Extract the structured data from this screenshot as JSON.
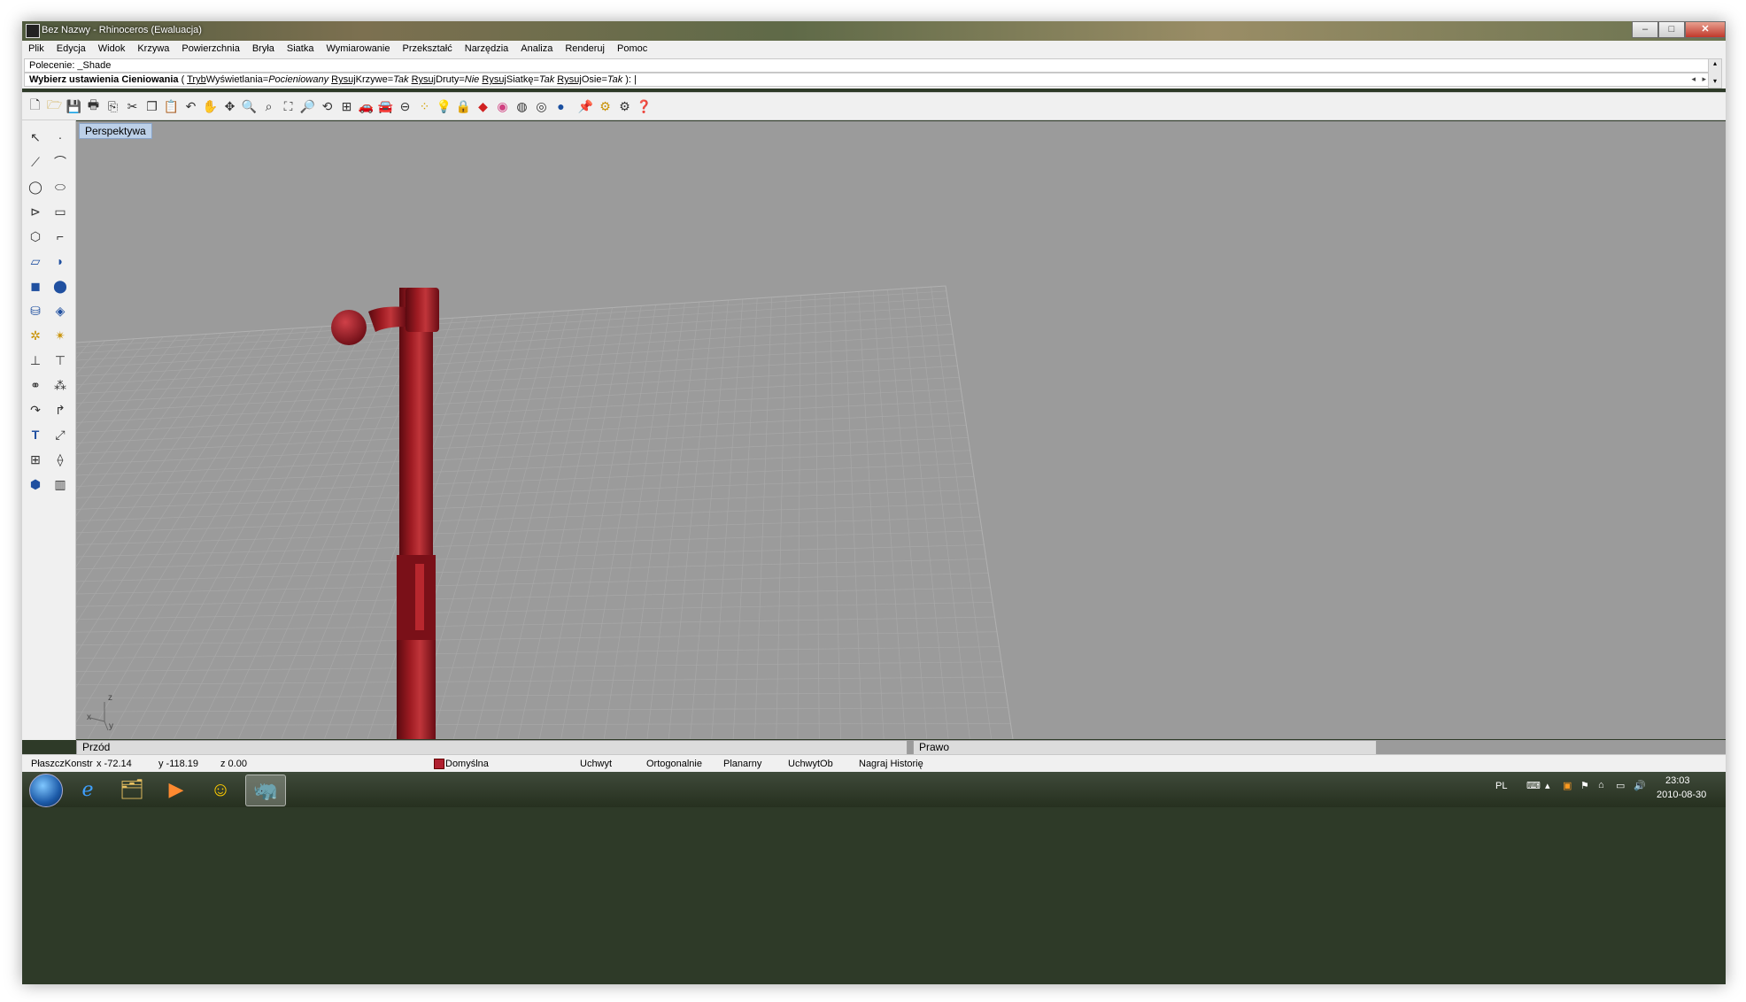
{
  "window": {
    "title": "Bez Nazwy - Rhinoceros (Ewaluacja)",
    "min_glyph": "–",
    "max_glyph": "□",
    "close_glyph": "✕"
  },
  "menu": [
    "Plik",
    "Edycja",
    "Widok",
    "Krzywa",
    "Powierzchnia",
    "Bryła",
    "Siatka",
    "Wymiarowanie",
    "Przekształć",
    "Narzędzia",
    "Analiza",
    "Renderuj",
    "Pomoc"
  ],
  "command": {
    "history": "Polecenie: _Shade",
    "prompt_bold": "Wybierz ustawienia Cieniowania",
    "opt1_key": "Tryb",
    "opt1_name": "Wyświetlania",
    "opt1_value": "Pocieniowany",
    "opt2_key": "Rysuj",
    "opt2_name": "Krzywe",
    "opt2_value": "Tak",
    "opt3_key": "Rysuj",
    "opt3_name": "Druty",
    "opt3_value": "Nie",
    "opt4_key": "Rysuj",
    "opt4_name": "Siatkę",
    "opt4_value": "Tak",
    "opt5_key": "Rysuj",
    "opt5_name": "Osie",
    "opt5_value": "Tak"
  },
  "toolbar_icons": [
    "new-file-icon",
    "open-folder-icon",
    "save-icon",
    "print-icon",
    "export-icon",
    "cut-icon",
    "copy-icon",
    "paste-icon",
    "undo-icon",
    "pan-hand-icon",
    "move-icon",
    "zoom-icon",
    "zoom-window-icon",
    "zoom-extents-icon",
    "zoom-selected-icon",
    "rotate-view-icon",
    "viewport-layout-icon",
    "car-icon",
    "car-outline-icon",
    "osnap-icon",
    "points-icon",
    "lightbulb-icon",
    "lock-icon",
    "layer-icon",
    "color-wheel-icon",
    "wireframe-sphere-icon",
    "shaded-sphere-icon",
    "rendered-sphere-icon",
    "pin-icon",
    "gear-icon",
    "options-icon",
    "help-icon"
  ],
  "left_tools": [
    "select-arrow-icon",
    "point-icon",
    "polyline-icon",
    "curve-edit-icon",
    "circle-icon",
    "ellipse-icon",
    "arc-icon",
    "rectangle-icon",
    "polygon-icon",
    "fillet-icon",
    "surface-icon",
    "surface-edit-icon",
    "box-icon",
    "boolean-icon",
    "cylinder-icon",
    "plane-icon",
    "transform-icon",
    "explode-icon",
    "split-icon",
    "trim-icon",
    "group-icon",
    "array-icon",
    "extend-icon",
    "chamfer-icon",
    "text-icon",
    "scale-icon",
    "block-icon",
    "dimension-icon",
    "cube-icon",
    "hatch-icon"
  ],
  "viewport": {
    "title": "Perspektywa",
    "axis_x": "x",
    "axis_y": "y",
    "axis_z": "z"
  },
  "bottom_viewports": {
    "front": "Przód",
    "right": "Prawo"
  },
  "status": {
    "plane": "PłaszczKonstr",
    "x": "x -72.14",
    "y": "y -118.19",
    "z": "z 0.00",
    "layer": "Domyślna",
    "snap": "Uchwyt",
    "ortho": "Ortogonalnie",
    "planar": "Planarny",
    "osnap": "UchwytOb",
    "history": "Nagraj Historię"
  },
  "tray": {
    "lang": "PL",
    "time": "23:03",
    "date": "2010-08-30"
  },
  "colors": {
    "model_red": "#9e1b22",
    "viewport_bg": "#9b9b9b",
    "grid_line": "#a8a8a8"
  }
}
